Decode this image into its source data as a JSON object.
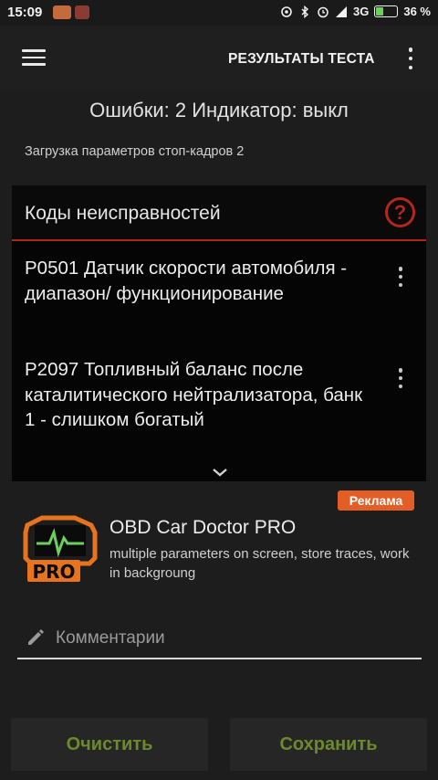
{
  "status_bar": {
    "time": "15:09",
    "network": "3G",
    "battery": "36 %",
    "battery_level": 0.36
  },
  "app_bar": {
    "title": "РЕЗУЛЬТАТЫ ТЕСТА"
  },
  "summary": {
    "errors_line": "Ошибки: 2 Индикатор: выкл",
    "freeze_frames": "Загрузка параметров стоп-кадров 2"
  },
  "codes_panel": {
    "title": "Коды неисправностей",
    "help_symbol": "?",
    "codes": [
      {
        "text": "P0501 Датчик скорости автомобиля - диапазон/ функционирование"
      },
      {
        "text": "P2097 Топливный баланс после каталитического нейтрализатора, банк 1 - слишком богатый"
      }
    ]
  },
  "ad": {
    "badge": "Реклама",
    "title": "OBD Car Doctor PRO",
    "description": "multiple parameters on screen, store traces, work in backgroung",
    "logo_text": "PRO"
  },
  "comment": {
    "placeholder": "Комментарии",
    "value": ""
  },
  "buttons": {
    "clear": "Очистить",
    "save": "Сохранить"
  },
  "colors": {
    "accent_red": "#b0271e",
    "ad_badge": "#e35d27",
    "button_text": "#6d8a2a",
    "logo_orange": "#e8731e",
    "logo_green": "#6bd15a"
  }
}
